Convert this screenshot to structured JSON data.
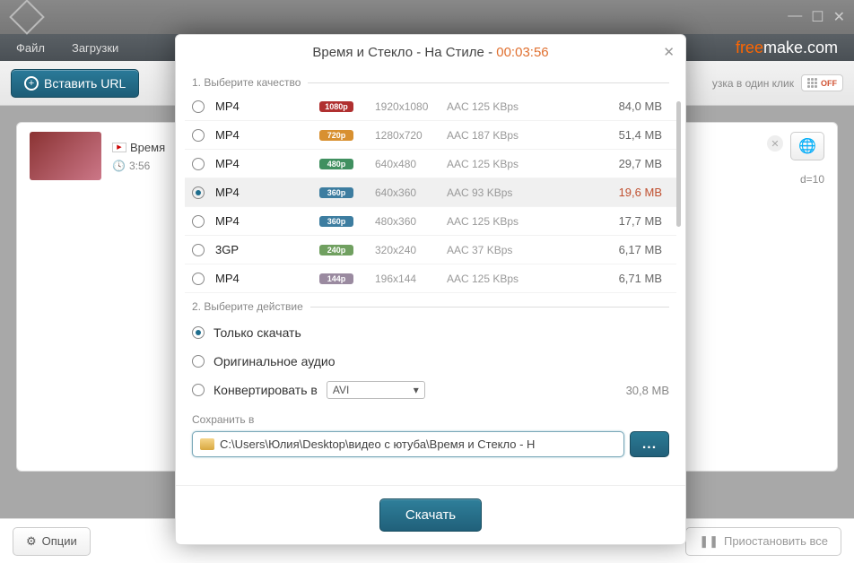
{
  "window": {
    "menu_file": "Файл",
    "menu_downloads": "Загрузки",
    "brand_prefix": "free",
    "brand_mid": "make",
    "brand_suffix": ".com",
    "paste_url": "Вставить URL",
    "one_click_hint": "узка в один клик",
    "one_click_state": "OFF",
    "options": "Опции",
    "pause_all": "Приостановить все"
  },
  "item": {
    "title_short": "Время",
    "duration": "3:56",
    "peek": "d=10"
  },
  "modal": {
    "title_main": "Время и Стекло - На Стиле",
    "title_time": "00:03:56",
    "section_quality": "1. Выберите качество",
    "section_action": "2. Выберите действие",
    "save_in": "Сохранить в",
    "path": "C:\\Users\\Юлия\\Desktop\\видео с ютуба\\Время и Стекло - Н",
    "browse": "...",
    "download": "Скачать",
    "convert_select": "AVI",
    "estimated_size": "30,8 MB",
    "qualities": [
      {
        "fmt": "MP4",
        "badge": "1080p",
        "bclass": "b1080",
        "res": "1920x1080",
        "audio": "AAC 125  KBps",
        "size": "84,0 MB",
        "icon": ""
      },
      {
        "fmt": "MP4",
        "badge": "720p",
        "bclass": "b720",
        "res": "1280x720",
        "audio": "AAC 187  KBps",
        "size": "51,4 MB",
        "icon": ""
      },
      {
        "fmt": "MP4",
        "badge": "480p",
        "bclass": "b480",
        "res": "640x480",
        "audio": "AAC 125  KBps",
        "size": "29,7 MB",
        "icon": ""
      },
      {
        "fmt": "MP4",
        "badge": "360p",
        "bclass": "b360",
        "res": "640x360",
        "audio": "AAC 93  KBps",
        "size": "19,6 MB",
        "icon": "",
        "selected": true
      },
      {
        "fmt": "MP4",
        "badge": "360p",
        "bclass": "b360",
        "res": "480x360",
        "audio": "AAC 125  KBps",
        "size": "17,7 MB",
        "icon": ""
      },
      {
        "fmt": "3GP",
        "badge": "240p",
        "bclass": "b240",
        "res": "320x240",
        "audio": "AAC 37  KBps",
        "size": "6,17 MB",
        "icon": ""
      },
      {
        "fmt": "MP4",
        "badge": "144p",
        "bclass": "b144",
        "res": "196x144",
        "audio": "AAC 125  KBps",
        "size": "6,71 MB",
        "icon": ""
      }
    ],
    "actions": {
      "download_only": "Только скачать",
      "original_audio": "Оригинальное аудио",
      "convert_to": "Конвертировать в"
    }
  }
}
